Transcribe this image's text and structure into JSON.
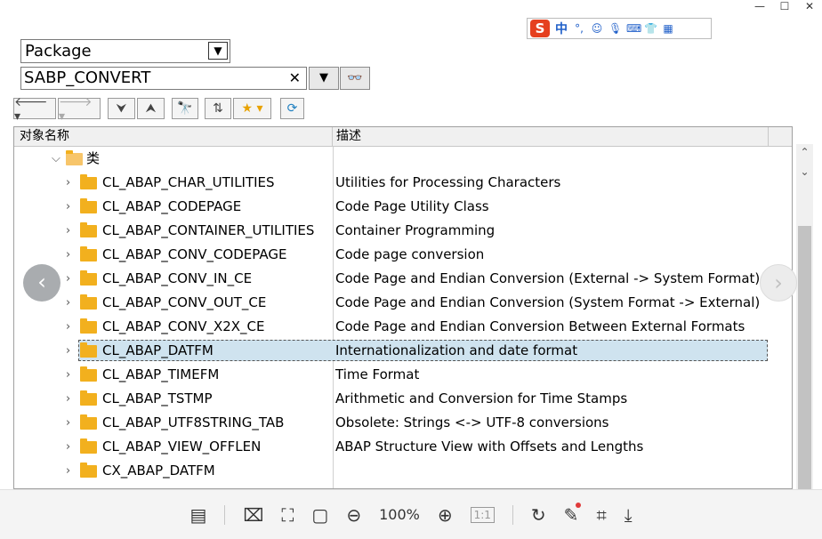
{
  "window": {
    "minimize": "—",
    "maximize": "☐",
    "close": "✕"
  },
  "ime": {
    "logo": "S",
    "lang": "中",
    "punct": "°,",
    "icons": [
      "smile-icon",
      "mic-icon",
      "keyboard-icon",
      "shirt-icon",
      "grid-icon"
    ]
  },
  "search": {
    "type_select": "Package",
    "object_value": "SABP_CONVERT",
    "clear": "✕"
  },
  "toolbar": {
    "back": "🡐 ▾",
    "forward": "🡒 ▾",
    "expand": "⮟",
    "collapse": "⮝",
    "find": "🔭",
    "hierarchy": "⇅",
    "favorites": "★ ▾",
    "refresh": "⟳"
  },
  "tree": {
    "col_name": "对象名称",
    "col_desc": "描述",
    "group_label": "类",
    "rows": [
      {
        "name": "CL_ABAP_CHAR_UTILITIES",
        "desc": "Utilities for Processing Characters"
      },
      {
        "name": "CL_ABAP_CODEPAGE",
        "desc": "Code Page Utility Class"
      },
      {
        "name": "CL_ABAP_CONTAINER_UTILITIES",
        "desc": "Container Programming"
      },
      {
        "name": "CL_ABAP_CONV_CODEPAGE",
        "desc": "Code page conversion"
      },
      {
        "name": "CL_ABAP_CONV_IN_CE",
        "desc": "Code Page and Endian Conversion (External -> System Format)"
      },
      {
        "name": "CL_ABAP_CONV_OUT_CE",
        "desc": "Code Page and Endian Conversion (System Format -> External)"
      },
      {
        "name": "CL_ABAP_CONV_X2X_CE",
        "desc": "Code Page and Endian Conversion Between External Formats"
      },
      {
        "name": "CL_ABAP_DATFM",
        "desc": "Internationalization and date format"
      },
      {
        "name": "CL_ABAP_TIMEFM",
        "desc": "Time Format"
      },
      {
        "name": "CL_ABAP_TSTMP",
        "desc": "Arithmetic and Conversion for Time Stamps"
      },
      {
        "name": "CL_ABAP_UTF8STRING_TAB",
        "desc": "Obsolete: Strings <-> UTF-8 conversions"
      },
      {
        "name": "CL_ABAP_VIEW_OFFLEN",
        "desc": "ABAP Structure View with Offsets and Lengths"
      },
      {
        "name": "CX_ABAP_DATFM",
        "desc": ""
      }
    ]
  },
  "viewer": {
    "zoom": "100%",
    "actual_size": "1:1"
  }
}
